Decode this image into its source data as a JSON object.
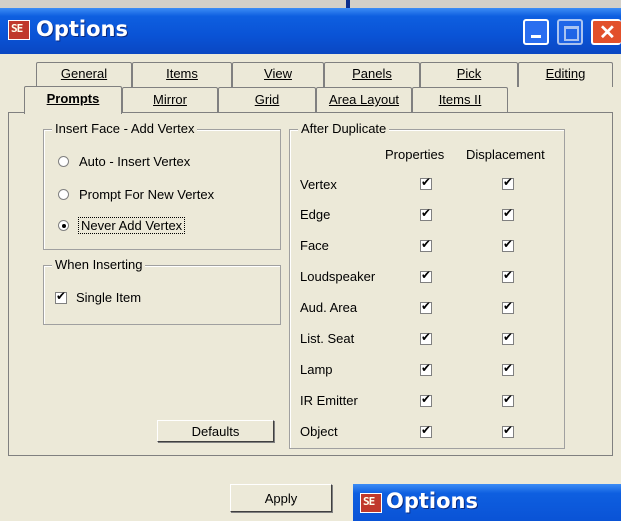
{
  "window": {
    "title": "Options",
    "icon": "app-logo-icon"
  },
  "tabs_row1": [
    {
      "label": "General"
    },
    {
      "label": "Items"
    },
    {
      "label": "View"
    },
    {
      "label": "Panels"
    },
    {
      "label": "Pick"
    },
    {
      "label": "Editing"
    }
  ],
  "tabs_row2": [
    {
      "label": "Prompts",
      "active": true
    },
    {
      "label": "Mirror"
    },
    {
      "label": "Grid"
    },
    {
      "label": "Area Layout"
    },
    {
      "label": "Items II"
    }
  ],
  "insert_face": {
    "title": "Insert Face - Add Vertex",
    "options": [
      {
        "label": "Auto - Insert Vertex",
        "selected": false
      },
      {
        "label": "Prompt For New Vertex",
        "selected": false
      },
      {
        "label": "Never Add Vertex",
        "selected": true
      }
    ]
  },
  "when_inserting": {
    "title": "When Inserting",
    "single_item": {
      "label": "Single Item",
      "checked": true
    }
  },
  "defaults_button": "Defaults",
  "after_duplicate": {
    "title": "After Duplicate",
    "col_properties": "Properties",
    "col_displacement": "Displacement",
    "rows": [
      {
        "label": "Vertex",
        "properties": true,
        "displacement": true
      },
      {
        "label": "Edge",
        "properties": true,
        "displacement": true
      },
      {
        "label": "Face",
        "properties": true,
        "displacement": true
      },
      {
        "label": "Loudspeaker",
        "properties": true,
        "displacement": true
      },
      {
        "label": "Aud. Area",
        "properties": true,
        "displacement": true
      },
      {
        "label": "List. Seat",
        "properties": true,
        "displacement": true
      },
      {
        "label": "Lamp",
        "properties": true,
        "displacement": true
      },
      {
        "label": "IR Emitter",
        "properties": true,
        "displacement": true
      },
      {
        "label": "Object",
        "properties": true,
        "displacement": true
      }
    ]
  },
  "apply_button": "Apply",
  "second_window": {
    "title": "Options"
  }
}
